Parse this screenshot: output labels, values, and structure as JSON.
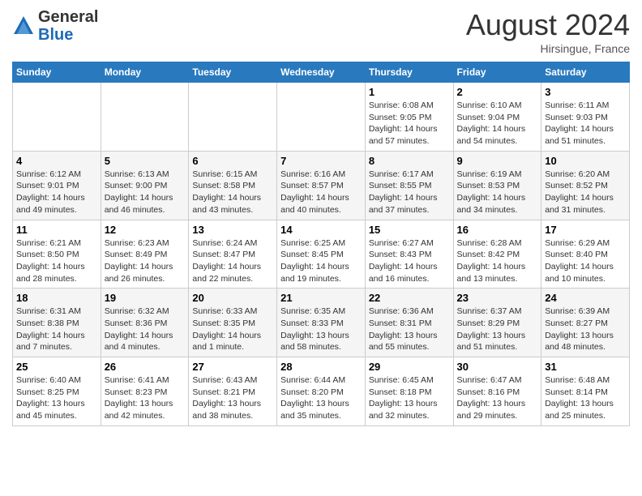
{
  "header": {
    "logo_general": "General",
    "logo_blue": "Blue",
    "month_title": "August 2024",
    "location": "Hirsingue, France"
  },
  "weekdays": [
    "Sunday",
    "Monday",
    "Tuesday",
    "Wednesday",
    "Thursday",
    "Friday",
    "Saturday"
  ],
  "weeks": [
    [
      {
        "day": "",
        "info": ""
      },
      {
        "day": "",
        "info": ""
      },
      {
        "day": "",
        "info": ""
      },
      {
        "day": "",
        "info": ""
      },
      {
        "day": "1",
        "info": "Sunrise: 6:08 AM\nSunset: 9:05 PM\nDaylight: 14 hours\nand 57 minutes."
      },
      {
        "day": "2",
        "info": "Sunrise: 6:10 AM\nSunset: 9:04 PM\nDaylight: 14 hours\nand 54 minutes."
      },
      {
        "day": "3",
        "info": "Sunrise: 6:11 AM\nSunset: 9:03 PM\nDaylight: 14 hours\nand 51 minutes."
      }
    ],
    [
      {
        "day": "4",
        "info": "Sunrise: 6:12 AM\nSunset: 9:01 PM\nDaylight: 14 hours\nand 49 minutes."
      },
      {
        "day": "5",
        "info": "Sunrise: 6:13 AM\nSunset: 9:00 PM\nDaylight: 14 hours\nand 46 minutes."
      },
      {
        "day": "6",
        "info": "Sunrise: 6:15 AM\nSunset: 8:58 PM\nDaylight: 14 hours\nand 43 minutes."
      },
      {
        "day": "7",
        "info": "Sunrise: 6:16 AM\nSunset: 8:57 PM\nDaylight: 14 hours\nand 40 minutes."
      },
      {
        "day": "8",
        "info": "Sunrise: 6:17 AM\nSunset: 8:55 PM\nDaylight: 14 hours\nand 37 minutes."
      },
      {
        "day": "9",
        "info": "Sunrise: 6:19 AM\nSunset: 8:53 PM\nDaylight: 14 hours\nand 34 minutes."
      },
      {
        "day": "10",
        "info": "Sunrise: 6:20 AM\nSunset: 8:52 PM\nDaylight: 14 hours\nand 31 minutes."
      }
    ],
    [
      {
        "day": "11",
        "info": "Sunrise: 6:21 AM\nSunset: 8:50 PM\nDaylight: 14 hours\nand 28 minutes."
      },
      {
        "day": "12",
        "info": "Sunrise: 6:23 AM\nSunset: 8:49 PM\nDaylight: 14 hours\nand 26 minutes."
      },
      {
        "day": "13",
        "info": "Sunrise: 6:24 AM\nSunset: 8:47 PM\nDaylight: 14 hours\nand 22 minutes."
      },
      {
        "day": "14",
        "info": "Sunrise: 6:25 AM\nSunset: 8:45 PM\nDaylight: 14 hours\nand 19 minutes."
      },
      {
        "day": "15",
        "info": "Sunrise: 6:27 AM\nSunset: 8:43 PM\nDaylight: 14 hours\nand 16 minutes."
      },
      {
        "day": "16",
        "info": "Sunrise: 6:28 AM\nSunset: 8:42 PM\nDaylight: 14 hours\nand 13 minutes."
      },
      {
        "day": "17",
        "info": "Sunrise: 6:29 AM\nSunset: 8:40 PM\nDaylight: 14 hours\nand 10 minutes."
      }
    ],
    [
      {
        "day": "18",
        "info": "Sunrise: 6:31 AM\nSunset: 8:38 PM\nDaylight: 14 hours\nand 7 minutes."
      },
      {
        "day": "19",
        "info": "Sunrise: 6:32 AM\nSunset: 8:36 PM\nDaylight: 14 hours\nand 4 minutes."
      },
      {
        "day": "20",
        "info": "Sunrise: 6:33 AM\nSunset: 8:35 PM\nDaylight: 14 hours\nand 1 minute."
      },
      {
        "day": "21",
        "info": "Sunrise: 6:35 AM\nSunset: 8:33 PM\nDaylight: 13 hours\nand 58 minutes."
      },
      {
        "day": "22",
        "info": "Sunrise: 6:36 AM\nSunset: 8:31 PM\nDaylight: 13 hours\nand 55 minutes."
      },
      {
        "day": "23",
        "info": "Sunrise: 6:37 AM\nSunset: 8:29 PM\nDaylight: 13 hours\nand 51 minutes."
      },
      {
        "day": "24",
        "info": "Sunrise: 6:39 AM\nSunset: 8:27 PM\nDaylight: 13 hours\nand 48 minutes."
      }
    ],
    [
      {
        "day": "25",
        "info": "Sunrise: 6:40 AM\nSunset: 8:25 PM\nDaylight: 13 hours\nand 45 minutes."
      },
      {
        "day": "26",
        "info": "Sunrise: 6:41 AM\nSunset: 8:23 PM\nDaylight: 13 hours\nand 42 minutes."
      },
      {
        "day": "27",
        "info": "Sunrise: 6:43 AM\nSunset: 8:21 PM\nDaylight: 13 hours\nand 38 minutes."
      },
      {
        "day": "28",
        "info": "Sunrise: 6:44 AM\nSunset: 8:20 PM\nDaylight: 13 hours\nand 35 minutes."
      },
      {
        "day": "29",
        "info": "Sunrise: 6:45 AM\nSunset: 8:18 PM\nDaylight: 13 hours\nand 32 minutes."
      },
      {
        "day": "30",
        "info": "Sunrise: 6:47 AM\nSunset: 8:16 PM\nDaylight: 13 hours\nand 29 minutes."
      },
      {
        "day": "31",
        "info": "Sunrise: 6:48 AM\nSunset: 8:14 PM\nDaylight: 13 hours\nand 25 minutes."
      }
    ]
  ]
}
